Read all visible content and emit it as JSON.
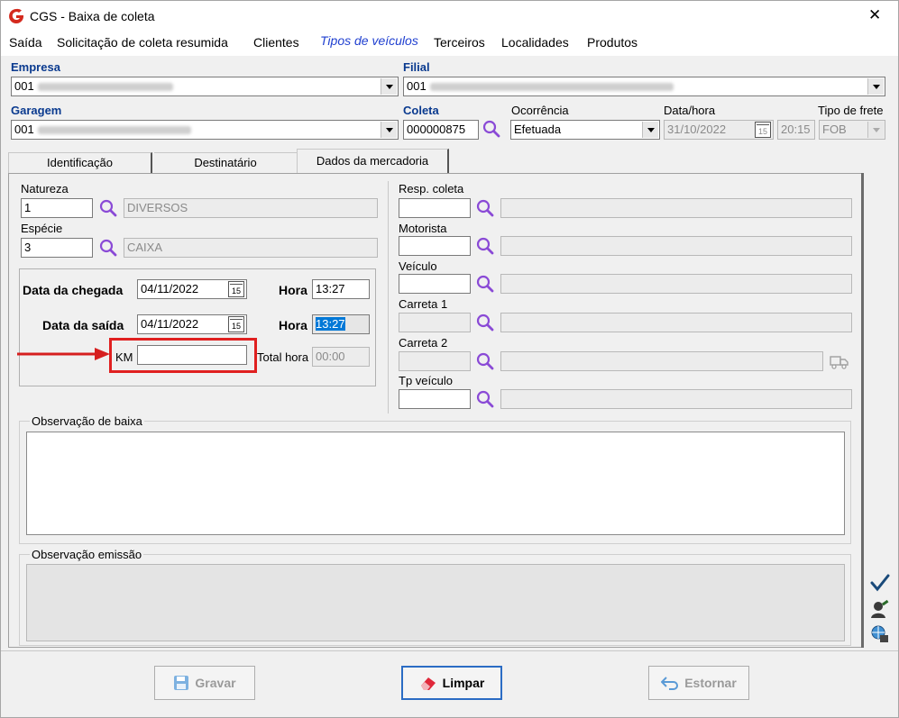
{
  "window": {
    "title": "CGS - Baixa de coleta",
    "close_glyph": "✕"
  },
  "menu": [
    "Saída",
    "Solicitação de coleta resumida",
    "Clientes",
    "Tipos de veículos",
    "Terceiros",
    "Localidades",
    "Produtos"
  ],
  "header": {
    "empresa_label": "Empresa",
    "empresa_code": "001",
    "filial_label": "Filial",
    "filial_code": "001",
    "garagem_label": "Garagem",
    "garagem_code": "001",
    "coleta_label": "Coleta",
    "coleta_value": "000000875",
    "ocorrencia_label": "Ocorrência",
    "ocorrencia_value": "Efetuada",
    "datahora_label": "Data/hora",
    "data_value": "31/10/2022",
    "hora_value": "20:15",
    "tipofrete_label": "Tipo de frete",
    "tipofrete_value": "FOB"
  },
  "tabs": [
    "Identificação",
    "Destinatário",
    "Dados da mercadoria"
  ],
  "left": {
    "natureza_label": "Natureza",
    "natureza_code": "1",
    "natureza_desc": "DIVERSOS",
    "especie_label": "Espécie",
    "especie_code": "3",
    "especie_desc": "CAIXA",
    "chegada_label": "Data da chegada",
    "chegada_date": "04/11/2022",
    "hora_label": "Hora",
    "chegada_hora": "13:27",
    "saida_label": "Data da saída",
    "saida_date": "04/11/2022",
    "saida_hora": "13:27",
    "km_label": "KM",
    "km_value": "",
    "totalhora_label": "Total hora",
    "totalhora_value": "00:00"
  },
  "right": {
    "resp_label": "Resp. coleta",
    "motorista_label": "Motorista",
    "veiculo_label": "Veículo",
    "carreta1_label": "Carreta 1",
    "carreta2_label": "Carreta 2",
    "tpveiculo_label": "Tp veículo"
  },
  "obs": {
    "baixa_label": "Observação de baixa",
    "emissao_label": "Observação emissão"
  },
  "buttons": {
    "gravar": "Gravar",
    "limpar": "Limpar",
    "estornar": "Estornar"
  },
  "calendar_glyph": "15",
  "colors": {
    "label_blue": "#0a3a8f",
    "logo_red": "#d42a1e",
    "highlight_box": "#e02020",
    "search_purple": "#8a4ad6"
  }
}
